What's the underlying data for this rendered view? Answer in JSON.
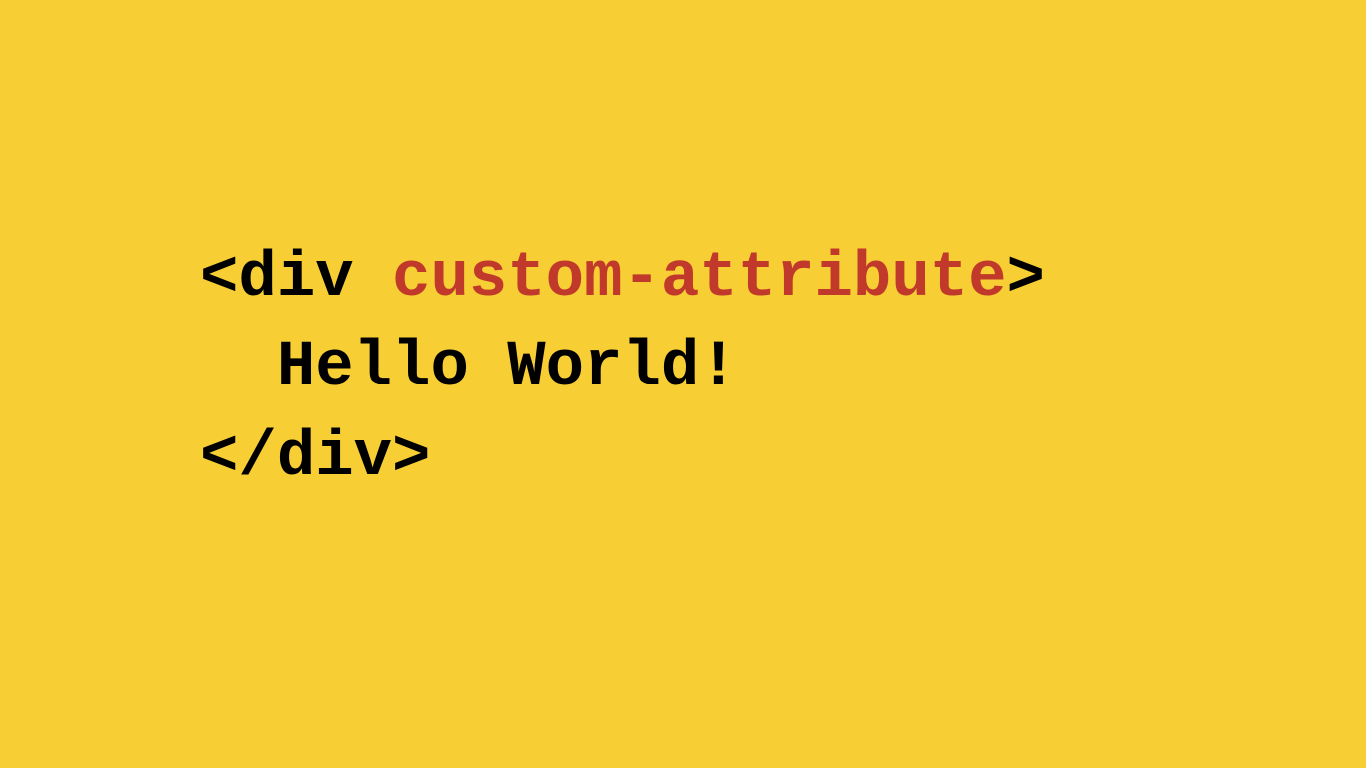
{
  "code": {
    "line1_open": "<div ",
    "line1_attr": "custom-attribute",
    "line1_close": ">",
    "line2": "  Hello World!",
    "line3": "</div>"
  }
}
